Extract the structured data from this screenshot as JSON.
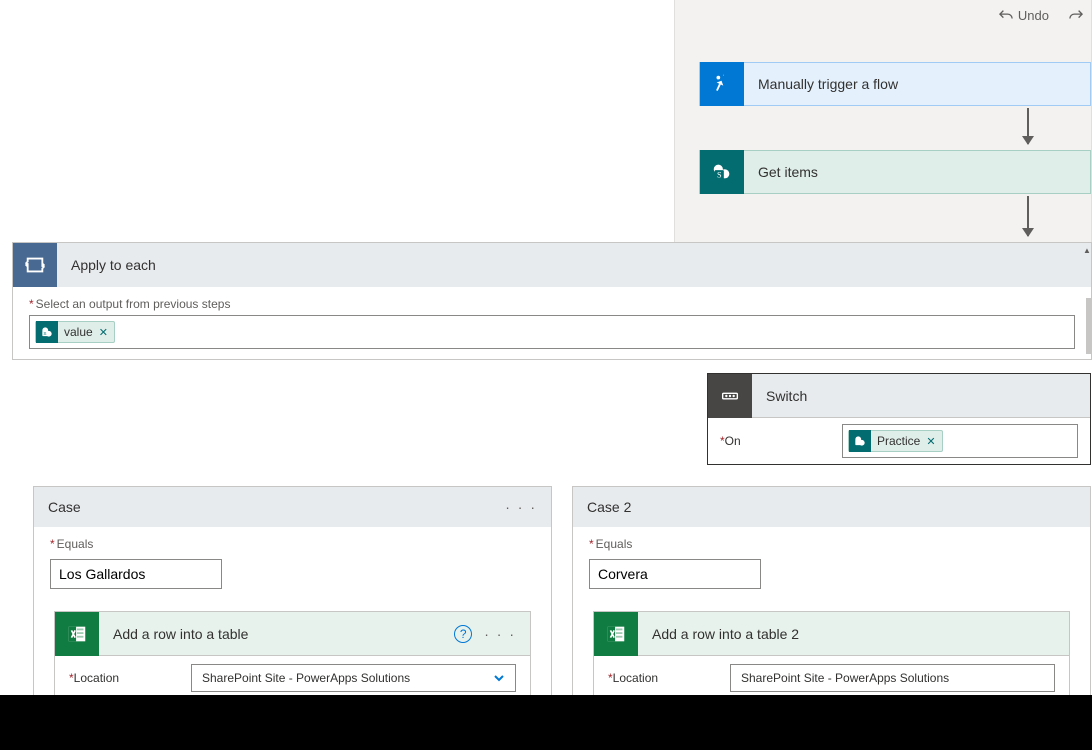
{
  "toolbar": {
    "undo": "Undo"
  },
  "trigger": {
    "label": "Manually trigger a flow"
  },
  "getitems": {
    "label": "Get items"
  },
  "applyEach": {
    "title": "Apply to each",
    "outputLabel": "Select an output from previous steps",
    "token": "value"
  },
  "switch": {
    "title": "Switch",
    "onLabel": "On",
    "token": "Practice"
  },
  "case1": {
    "title": "Case",
    "equalsLabel": "Equals",
    "equalsValue": "Los Gallardos",
    "action": {
      "title": "Add a row into a table",
      "locationLabel": "Location",
      "locationValue": "SharePoint Site - PowerApps Solutions"
    }
  },
  "case2": {
    "title": "Case 2",
    "equalsLabel": "Equals",
    "equalsValue": "Corvera",
    "action": {
      "title": "Add a row into a table 2",
      "locationLabel": "Location",
      "locationValue": "SharePoint Site - PowerApps Solutions"
    }
  }
}
